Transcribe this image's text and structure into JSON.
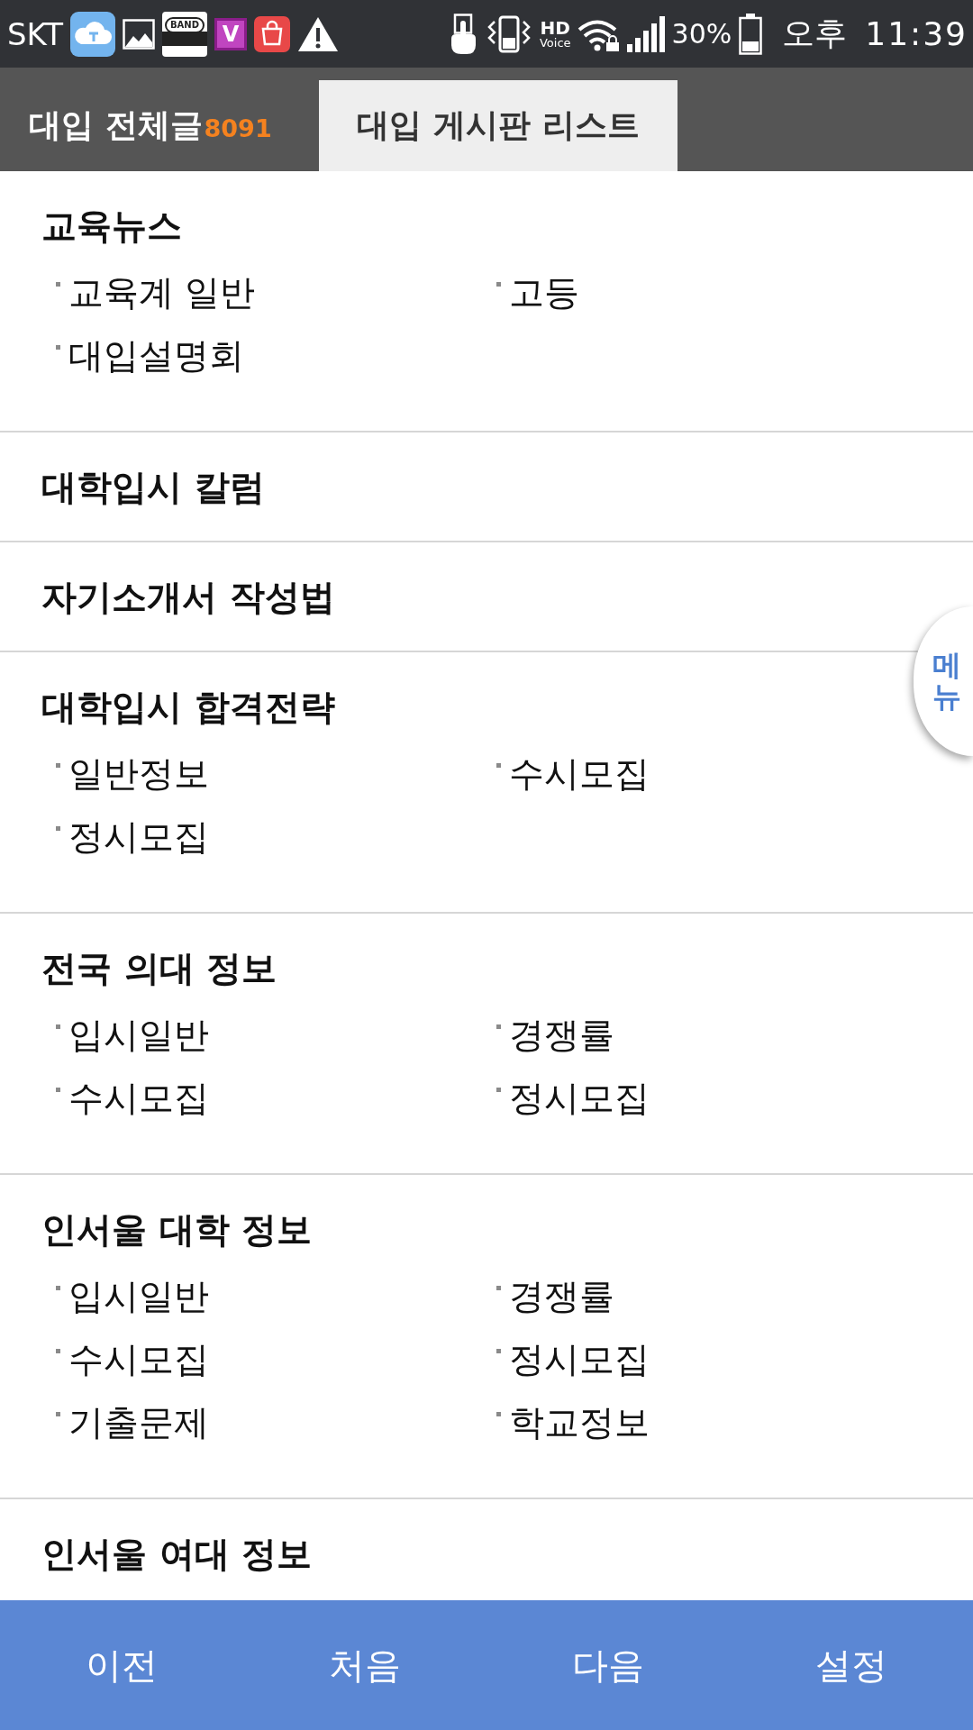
{
  "status_bar": {
    "carrier": "SKT",
    "notifications": [
      {
        "kind": "cloud"
      },
      {
        "kind": "image"
      },
      {
        "kind": "band",
        "label": "BAND"
      },
      {
        "kind": "v",
        "label": "V"
      },
      {
        "kind": "bag"
      },
      {
        "kind": "warning"
      }
    ],
    "hd_voice": {
      "top": "HD",
      "bottom": "Voice"
    },
    "battery_text": "30%",
    "period": "오후",
    "time": "11:39"
  },
  "tabs": [
    {
      "label": "대입 전체글",
      "count": "8091",
      "selected": false
    },
    {
      "label": "대입 게시판 리스트",
      "selected": true
    }
  ],
  "sections": [
    {
      "title": "교육뉴스",
      "items": [
        "교육계 일반",
        "고등",
        "대입설명회"
      ]
    },
    {
      "title": "대학입시 칼럼"
    },
    {
      "title": "자기소개서 작성법"
    },
    {
      "title": "대학입시 합격전략",
      "items": [
        "일반정보",
        "수시모집",
        "정시모집"
      ]
    },
    {
      "title": "전국 의대 정보",
      "items": [
        "입시일반",
        "경쟁률",
        "수시모집",
        "정시모집"
      ]
    },
    {
      "title": "인서울 대학 정보",
      "items": [
        "입시일반",
        "경쟁률",
        "수시모집",
        "정시모집",
        "기출문제",
        "학교정보"
      ]
    },
    {
      "title": "인서울 여대 정보"
    }
  ],
  "menu_button": {
    "label": "메뉴"
  },
  "bottom_nav": [
    {
      "label": "이전"
    },
    {
      "label": "처음"
    },
    {
      "label": "다음"
    },
    {
      "label": "설정"
    }
  ]
}
